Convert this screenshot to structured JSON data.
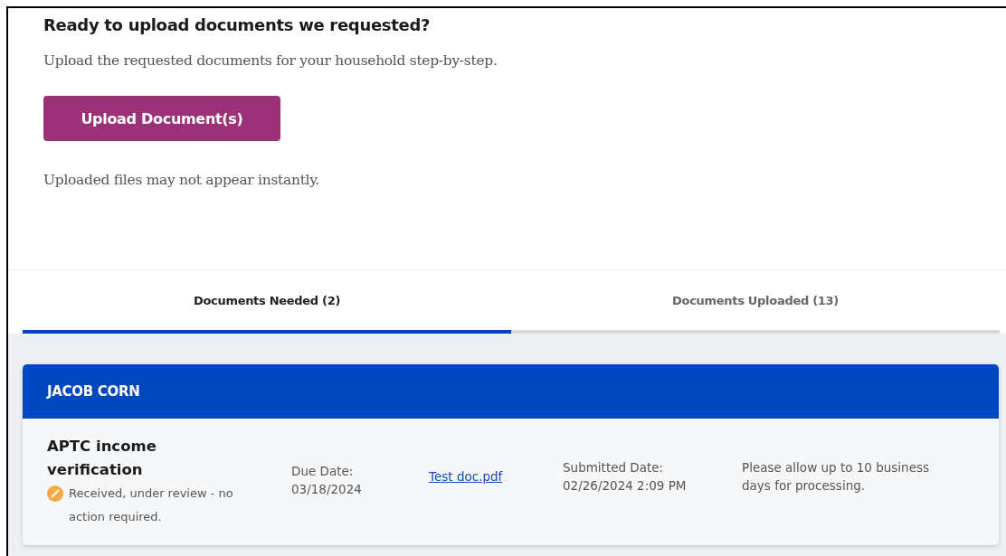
{
  "intro": {
    "heading": "Ready to upload documents we requested?",
    "description": "Upload the requested documents for your household step-by-step.",
    "button": "Upload Document(s)",
    "note": "Uploaded files may not appear instantly."
  },
  "tabs": [
    {
      "label": "Documents Needed (2)",
      "selected": true
    },
    {
      "label": "Documents Uploaded (13)",
      "selected": false
    }
  ],
  "person": {
    "name": "JACOB CORN",
    "documents": [
      {
        "title": "APTC income verification",
        "status": "Received, under review - no action required.",
        "due_label": "Due Date:",
        "due_date": "03/18/2024",
        "file": "Test doc.pdf",
        "submitted_label": "Submitted Date:",
        "submitted_date": "02/26/2024 2:09 PM",
        "message": "Please allow up to 10 business days for processing."
      }
    ]
  }
}
